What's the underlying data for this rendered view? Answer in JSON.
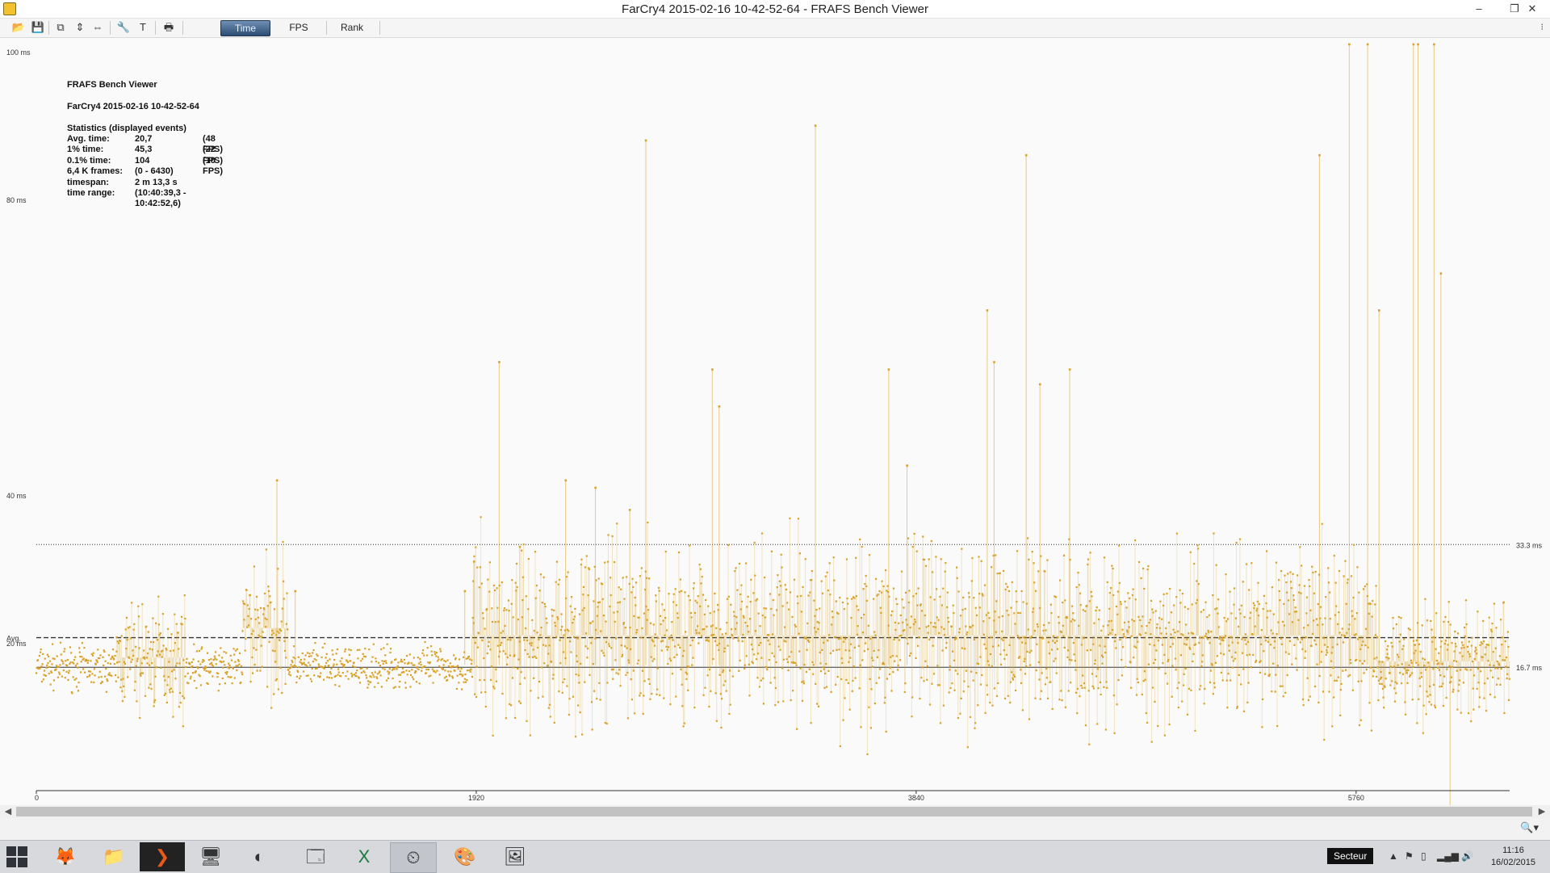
{
  "window": {
    "title": "FarCry4 2015-02-16 10-42-52-64 - FRAFS Bench Viewer",
    "minimize_label": "–",
    "restore_label": "❐",
    "close_label": "✕"
  },
  "toolbar": {
    "tabs": [
      "Time",
      "FPS",
      "Rank"
    ],
    "active_tab": "Time",
    "more_label": "⁝"
  },
  "stats": {
    "app_name": "FRAFS Bench Viewer",
    "file_name": "FarCry4 2015-02-16 10-42-52-64",
    "header": "Statistics (displayed events)",
    "rows": [
      [
        "Avg. time:",
        "20,7",
        "(48 FPS)"
      ],
      [
        "1% time:",
        "45,3",
        "(22 FPS)"
      ],
      [
        "0.1% time:",
        "104",
        "(10 FPS)"
      ],
      [
        "6,4 K frames:",
        "(0 - 6430)",
        ""
      ],
      [
        "timespan:",
        "2 m 13,3 s",
        ""
      ],
      [
        "time range:",
        "(10:40:39,3 - 10:42:52,6)",
        ""
      ]
    ]
  },
  "chart_data": {
    "type": "scatter",
    "title": "",
    "xlabel": "",
    "ylabel": "",
    "xlim": [
      0,
      6430
    ],
    "ylim": [
      0,
      100
    ],
    "x_ticks": [
      "0",
      "1920",
      "3840",
      "5760"
    ],
    "x_tick_values": [
      0,
      1920,
      3840,
      5760
    ],
    "y_ticks": [
      "100 ms",
      "80 ms",
      "40 ms",
      "20 ms"
    ],
    "y_tick_values": [
      100,
      80,
      40,
      20
    ],
    "reference_lines": [
      {
        "label": "33.3 ms",
        "value": 33.3,
        "style": "dotted"
      },
      {
        "label": "Avg.",
        "value": 20.7,
        "style": "dashed"
      },
      {
        "label": "16.7 ms",
        "value": 16.7,
        "style": "solid"
      }
    ],
    "series_color": "#d9a228",
    "segments": [
      {
        "x_start": 0,
        "x_end": 350,
        "center": 16.7,
        "spread": 3
      },
      {
        "x_start": 350,
        "x_end": 650,
        "center": 18,
        "spread": 8
      },
      {
        "x_start": 650,
        "x_end": 900,
        "center": 16.7,
        "spread": 3
      },
      {
        "x_start": 900,
        "x_end": 1100,
        "center": 22,
        "spread": 10
      },
      {
        "x_start": 1100,
        "x_end": 1900,
        "center": 16.7,
        "spread": 3
      },
      {
        "x_start": 1900,
        "x_end": 5850,
        "center": 21,
        "spread": 13
      },
      {
        "x_start": 5850,
        "x_end": 6430,
        "center": 17.5,
        "spread": 8
      }
    ],
    "spikes": [
      [
        1050,
        42
      ],
      [
        1130,
        27
      ],
      [
        1870,
        27
      ],
      [
        1910,
        31
      ],
      [
        2020,
        58
      ],
      [
        2110,
        33
      ],
      [
        2310,
        42
      ],
      [
        2440,
        41
      ],
      [
        2590,
        38
      ],
      [
        2660,
        88
      ],
      [
        2950,
        57
      ],
      [
        2980,
        52
      ],
      [
        3400,
        90
      ],
      [
        3720,
        57
      ],
      [
        3800,
        44
      ],
      [
        4150,
        65
      ],
      [
        4180,
        58
      ],
      [
        4320,
        86
      ],
      [
        4380,
        55
      ],
      [
        4510,
        57
      ],
      [
        5600,
        86
      ],
      [
        5730,
        101
      ],
      [
        5810,
        101
      ],
      [
        5860,
        65
      ],
      [
        6010,
        101
      ],
      [
        6030,
        101
      ],
      [
        6100,
        101
      ],
      [
        6130,
        70
      ],
      [
        6170,
        -6
      ]
    ]
  },
  "taskbar": {
    "apps": [
      "firefox-icon",
      "explorer-icon",
      "steam-icon",
      "frafs-icon",
      "ccleaner-icon",
      "control-panel-icon",
      "excel-icon",
      "bench-viewer-icon",
      "paint-icon",
      "photos-icon"
    ],
    "tray_tooltip": "Secteur",
    "time": "11:16",
    "date": "16/02/2015"
  }
}
